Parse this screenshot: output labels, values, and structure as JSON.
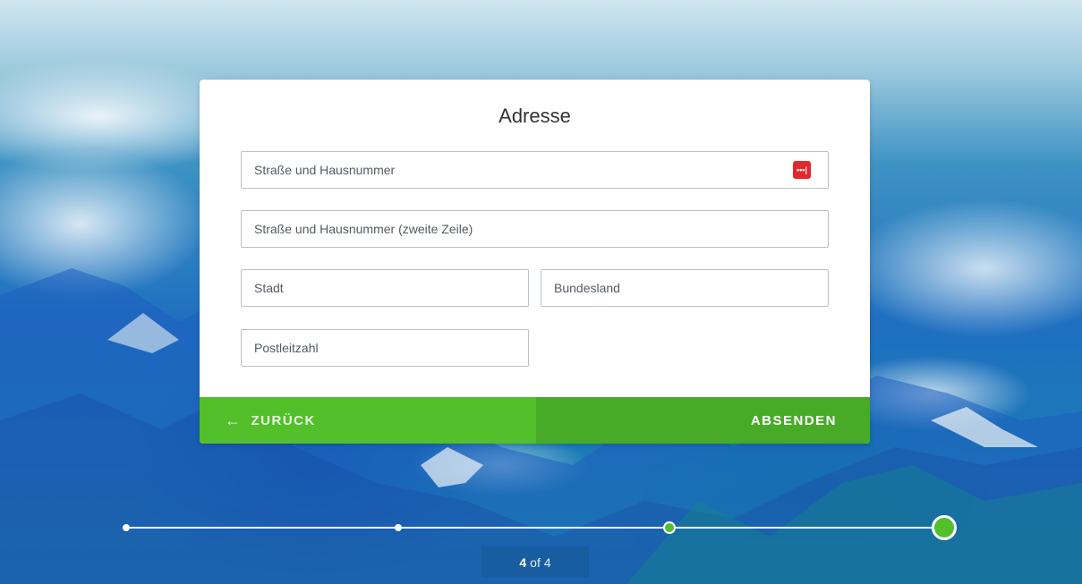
{
  "form": {
    "title": "Adresse",
    "street_placeholder": "Straße und Hausnummer",
    "street2_placeholder": "Straße und Hausnummer (zweite Zeile)",
    "city_placeholder": "Stadt",
    "state_placeholder": "Bundesland",
    "zip_placeholder": "Postleitzahl",
    "password_manager_icon": "lastpass-dots-icon",
    "password_manager_glyph": "•••|"
  },
  "actions": {
    "back_label": "ZURÜCK",
    "back_icon": "arrow-left-icon",
    "back_glyph": "←",
    "submit_label": "ABSENDEN"
  },
  "progress": {
    "current": "4",
    "of_label": "of",
    "total": "4",
    "value": 1.0
  },
  "colors": {
    "primary_green": "#52bf2b",
    "dark_green": "#47ab27",
    "password_icon_red": "#e3282b"
  }
}
